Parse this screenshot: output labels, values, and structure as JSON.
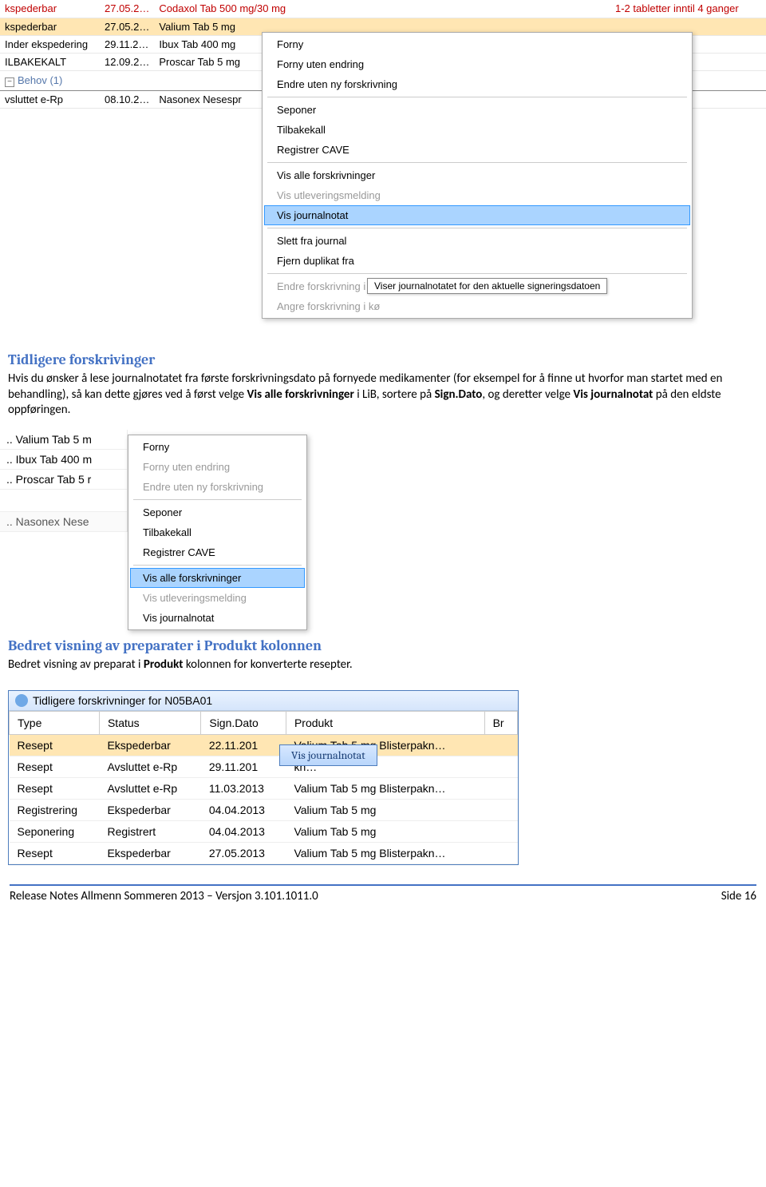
{
  "shot1": {
    "rows": [
      {
        "status": "kspederbar",
        "date": "27.05.2…",
        "prod": "Codaxol Tab 500 mg/30 mg",
        "dose": "1-2 tabletter inntil 4 ganger",
        "cls": "row-red"
      },
      {
        "status": "kspederbar",
        "date": "27.05.2…",
        "prod": "Valium Tab 5 mg",
        "dose": "",
        "cls": "row-orange"
      },
      {
        "status": "Inder ekspedering",
        "date": "29.11.2…",
        "prod": "Ibux Tab 400 mg",
        "dose": "",
        "cls": ""
      },
      {
        "status": "ILBAKEKALT",
        "date": "12.09.2…",
        "prod": "Proscar Tab 5 mg",
        "dose": "",
        "cls": ""
      }
    ],
    "group_label": "Behov (1)",
    "row_after": {
      "status": "vsluttet e-Rp",
      "date": "08.10.2…",
      "prod": "Nasonex Nesespr",
      "dose": ""
    },
    "menu": [
      {
        "label": "Forny",
        "type": "item"
      },
      {
        "label": "Forny uten endring",
        "type": "item"
      },
      {
        "label": "Endre uten ny forskrivning",
        "type": "item"
      },
      {
        "type": "sep"
      },
      {
        "label": "Seponer",
        "type": "item"
      },
      {
        "label": "Tilbakekall",
        "type": "item"
      },
      {
        "label": "Registrer CAVE",
        "type": "item"
      },
      {
        "type": "sep"
      },
      {
        "label": "Vis alle forskrivninger",
        "type": "item"
      },
      {
        "label": "Vis utleveringsmelding",
        "type": "item",
        "disabled": true
      },
      {
        "label": "Vis journalnotat",
        "type": "item",
        "sel": true
      },
      {
        "type": "sep"
      },
      {
        "label": "Slett fra journal",
        "type": "item"
      },
      {
        "label": "Fjern duplikat fra",
        "type": "item"
      },
      {
        "type": "sep"
      },
      {
        "label": "Endre forskrivning i kø",
        "type": "item",
        "disabled": true
      },
      {
        "label": "Angre forskrivning i kø",
        "type": "item",
        "disabled": true
      }
    ],
    "tooltip": "Viser journalnotatet for den aktuelle signeringsdatoen"
  },
  "section1": {
    "heading": "Tidligere forskrivinger",
    "text_1": "Hvis du ønsker å lese journalnotatet fra første forskrivningsdato på fornyede medikamenter (for eksempel for å finne ut hvorfor man startet med en behandling), så kan dette gjøres ved å først velge ",
    "bold_1": "Vis alle forskrivninger",
    "text_2": " i LiB, sortere på ",
    "bold_2": "Sign.Dato",
    "text_3": ", og deretter velge ",
    "bold_3": "Vis journalnotat",
    "text_4": " på den eldste oppføringen."
  },
  "shot2": {
    "list": [
      {
        "label": "..   Valium Tab 5 m"
      },
      {
        "label": "..   Ibux Tab 400 m"
      },
      {
        "label": "..   Proscar Tab 5 r"
      },
      {
        "label": "",
        "blank": true
      },
      {
        "label": "..   Nasonex Nese",
        "gray": true
      }
    ],
    "menu": [
      {
        "label": "Forny",
        "type": "item"
      },
      {
        "label": "Forny uten endring",
        "type": "item",
        "disabled": true
      },
      {
        "label": "Endre uten ny forskrivning",
        "type": "item",
        "disabled": true
      },
      {
        "type": "sep"
      },
      {
        "label": "Seponer",
        "type": "item"
      },
      {
        "label": "Tilbakekall",
        "type": "item"
      },
      {
        "label": "Registrer CAVE",
        "type": "item"
      },
      {
        "type": "sep"
      },
      {
        "label": "Vis alle forskrivninger",
        "type": "item",
        "sel": true
      },
      {
        "label": "Vis utleveringsmelding",
        "type": "item",
        "disabled": true
      },
      {
        "label": "Vis journalnotat",
        "type": "item"
      }
    ]
  },
  "section2": {
    "heading": "Bedret visning av preparater i Produkt kolonnen",
    "text_1": "Bedret visning av preparat i ",
    "bold_1": "Produkt",
    "text_2": " kolonnen for konverterte resepter."
  },
  "shot3": {
    "title": "Tidligere forskrivninger for N05BA01",
    "headers": [
      "Type",
      "Status",
      "Sign.Dato",
      "Produkt",
      "Br"
    ],
    "rows": [
      {
        "c": [
          "Resept",
          "Ekspederbar",
          "22.11.201",
          "Valium Tab 5 mg Blisterpakn…",
          ""
        ],
        "sel": true
      },
      {
        "c": [
          "Resept",
          "Avsluttet e-Rp",
          "29.11.201",
          "                                                kn…",
          ""
        ]
      },
      {
        "c": [
          "Resept",
          "Avsluttet e-Rp",
          "11.03.2013",
          "Valium Tab 5 mg Blisterpakn…",
          ""
        ]
      },
      {
        "c": [
          "Registrering",
          "Ekspederbar",
          "04.04.2013",
          "Valium Tab 5 mg",
          ""
        ]
      },
      {
        "c": [
          "Seponering",
          "Registrert",
          "04.04.2013",
          "Valium Tab 5 mg",
          ""
        ]
      },
      {
        "c": [
          "Resept",
          "Ekspederbar",
          "27.05.2013",
          "Valium Tab 5 mg Blisterpakn…",
          ""
        ]
      }
    ],
    "button": "Vis journalnotat"
  },
  "footer": {
    "left": "Release Notes Allmenn Sommeren 2013 – Versjon 3.101.1011.0",
    "right": "Side 16"
  }
}
